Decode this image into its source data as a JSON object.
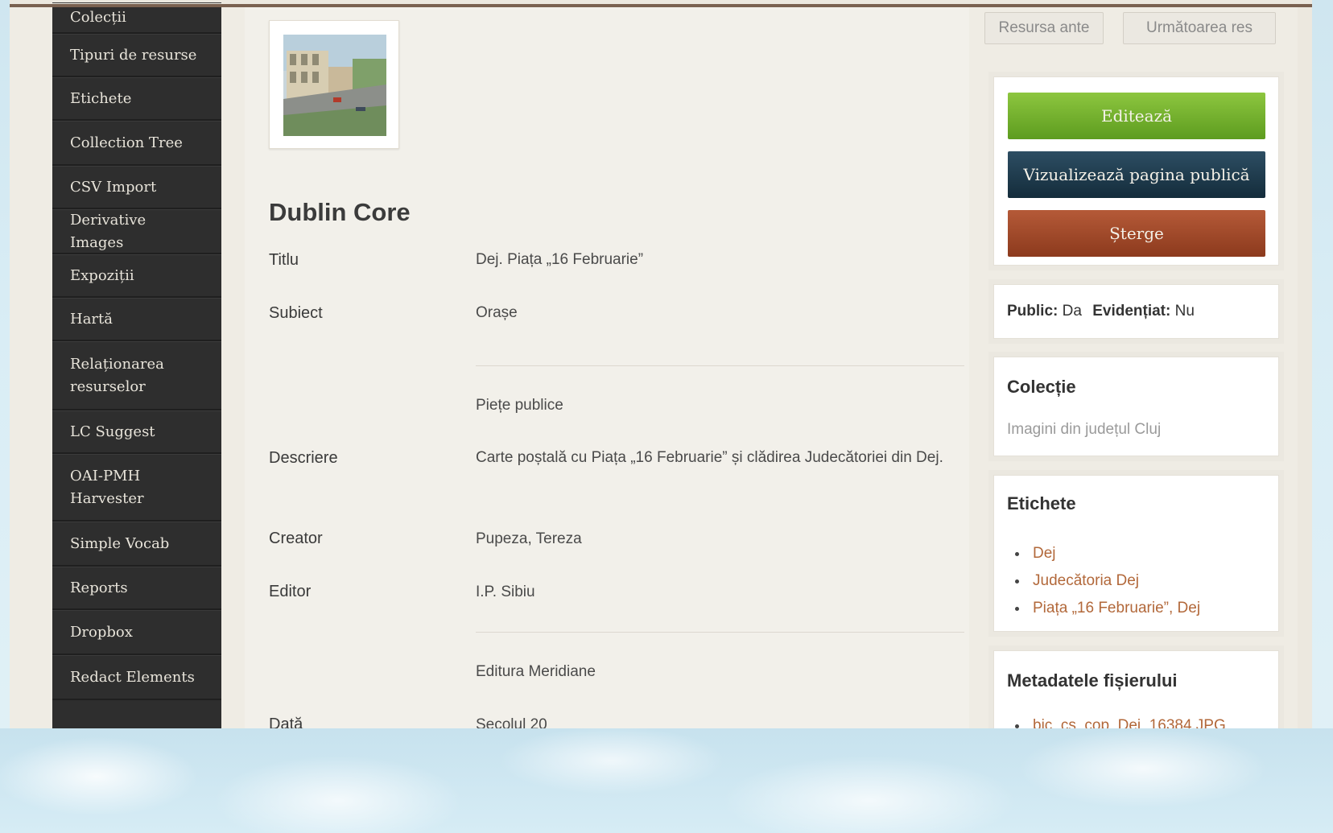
{
  "sidebar": {
    "items": [
      {
        "label": "Colecții"
      },
      {
        "label": "Tipuri de resurse"
      },
      {
        "label": "Etichete"
      },
      {
        "label": "Collection Tree"
      },
      {
        "label": "CSV Import"
      },
      {
        "label": "Derivative Images"
      },
      {
        "label": "Expoziții"
      },
      {
        "label": "Hartă"
      },
      {
        "label": "Relaționarea resurselor"
      },
      {
        "label": "LC Suggest"
      },
      {
        "label": "OAI-PMH Harvester"
      },
      {
        "label": "Simple Vocab"
      },
      {
        "label": "Reports"
      },
      {
        "label": "Dropbox"
      },
      {
        "label": "Redact Elements"
      }
    ]
  },
  "main": {
    "section_title": "Dublin Core",
    "fields": {
      "titlu": {
        "label": "Titlu",
        "value": "Dej. Piața „16 Februarie”"
      },
      "subiect": {
        "label": "Subiect",
        "value": "Orașe",
        "value2": "Piețe publice"
      },
      "descriere": {
        "label": "Descriere",
        "value": "Carte poștală cu Piața „16 Februarie” și clădirea Judecătoriei din Dej."
      },
      "creator": {
        "label": "Creator",
        "value": "Pupeza, Tereza"
      },
      "editor": {
        "label": "Editor",
        "value": "I.P. Sibiu",
        "value2": "Editura Meridiane"
      },
      "data": {
        "label": "Dată",
        "value": "Secolul 20"
      }
    }
  },
  "right": {
    "prev_label": "Resursa ante",
    "next_label": "Următoarea res",
    "edit_label": "Editează",
    "view_public_label": "Vizualizează pagina publică",
    "delete_label": "Șterge",
    "status": {
      "public_label": "Public:",
      "public_value": "Da",
      "featured_label": "Evidențiat:",
      "featured_value": "Nu"
    },
    "collection": {
      "title": "Colecție",
      "value": "Imagini din județul Cluj"
    },
    "tags": {
      "title": "Etichete",
      "items": [
        "Dej",
        "Judecătoria Dej",
        "Piața „16 Februarie”, Dej"
      ]
    },
    "file_metadata": {
      "title": "Metadatele fișierului",
      "file": "bjc_cs_cop_Dej_16384.JPG"
    }
  },
  "colors": {
    "sidebar_bg": "#2e2e2e",
    "edit_btn": "#6fae2a",
    "view_btn": "#1f3a4c",
    "delete_btn": "#a24a28",
    "tag_link": "#b2683a"
  }
}
